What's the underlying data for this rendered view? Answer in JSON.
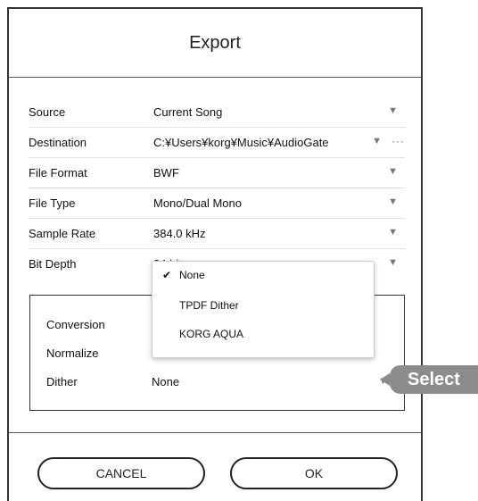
{
  "dialog": {
    "title": "Export",
    "settings": [
      {
        "label": "Source",
        "value": "Current Song"
      },
      {
        "label": "Destination",
        "value": "C:¥Users¥korg¥Music¥AudioGate"
      },
      {
        "label": "File Format",
        "value": "BWF"
      },
      {
        "label": "File Type",
        "value": "Mono/Dual Mono"
      },
      {
        "label": "Sample Rate",
        "value": "384.0 kHz"
      },
      {
        "label": "Bit Depth",
        "value": "24 bit"
      }
    ],
    "more_glyph": "···",
    "arrow_glyph": "▼",
    "panel": {
      "conversion_label": "Conversion",
      "normalize_label": "Normalize",
      "dither_label": "Dither",
      "dither_value": "None"
    },
    "dropdown": {
      "check_glyph": "✔",
      "options": [
        {
          "label": "None",
          "selected": true
        },
        {
          "label": "TPDF Dither",
          "selected": false
        },
        {
          "label": "KORG AQUA",
          "selected": false
        }
      ]
    },
    "buttons": {
      "cancel": "CANCEL",
      "ok": "OK"
    }
  },
  "callout": {
    "label": "Select",
    "color": "#8c8c8c"
  }
}
